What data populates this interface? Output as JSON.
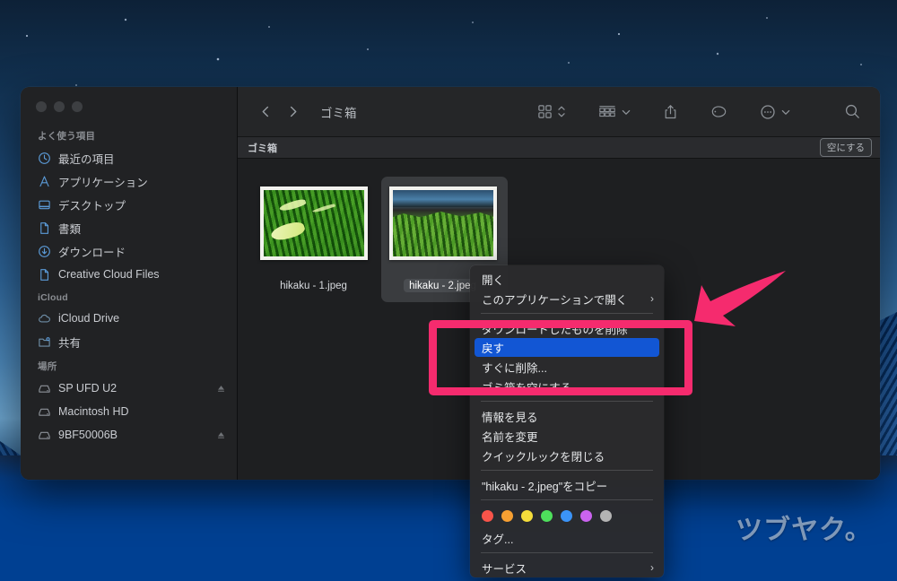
{
  "desktop": {
    "watermark": "ツブヤク。"
  },
  "window": {
    "title": "ゴミ箱",
    "traffic_lights": [
      "close",
      "minimize",
      "zoom"
    ]
  },
  "toolbar": {
    "back_icon": "chevron-left-icon",
    "forward_icon": "chevron-right-icon",
    "view_icon": "grid-view-icon",
    "view_stepper_icon": "chevron-updown-icon",
    "group_icon": "group-by-icon",
    "group_chevron_icon": "chevron-down-icon",
    "share_icon": "share-icon",
    "tag_icon": "tag-icon",
    "more_icon": "ellipsis-circle-icon",
    "more_chevron_icon": "chevron-down-icon",
    "search_icon": "search-icon"
  },
  "pathbar": {
    "title": "ゴミ箱",
    "empty_button": "空にする"
  },
  "sidebar": {
    "groups": [
      {
        "label": "よく使う項目",
        "items": [
          {
            "label": "最近の項目",
            "icon": "clock-icon"
          },
          {
            "label": "アプリケーション",
            "icon": "applications-icon"
          },
          {
            "label": "デスクトップ",
            "icon": "desktop-icon"
          },
          {
            "label": "書類",
            "icon": "document-icon"
          },
          {
            "label": "ダウンロード",
            "icon": "download-icon"
          },
          {
            "label": "Creative Cloud Files",
            "icon": "document-icon"
          }
        ]
      },
      {
        "label": "iCloud",
        "items": [
          {
            "label": "iCloud Drive",
            "icon": "cloud-icon"
          },
          {
            "label": "共有",
            "icon": "shared-folder-icon"
          }
        ]
      },
      {
        "label": "場所",
        "items": [
          {
            "label": "SP UFD U2",
            "icon": "drive-icon",
            "eject": true
          },
          {
            "label": "Macintosh HD",
            "icon": "drive-icon"
          },
          {
            "label": "9BF50006B",
            "icon": "drive-icon"
          }
        ]
      }
    ]
  },
  "files": [
    {
      "name": "hikaku - 1.jpeg",
      "selected": false
    },
    {
      "name": "hikaku - 2.jpeg",
      "selected": true
    }
  ],
  "context_menu": {
    "items": [
      {
        "label": "開く",
        "type": "item"
      },
      {
        "label": "このアプリケーションで開く",
        "type": "submenu",
        "arrow": "›"
      },
      {
        "type": "separator"
      },
      {
        "label": "ダウンロードしたものを削除",
        "type": "item"
      },
      {
        "label": "戻す",
        "type": "item",
        "highlighted": true
      },
      {
        "label": "すぐに削除...",
        "type": "item"
      },
      {
        "label": "ゴミ箱を空にする",
        "type": "item"
      },
      {
        "type": "separator"
      },
      {
        "label": "情報を見る",
        "type": "item"
      },
      {
        "label": "名前を変更",
        "type": "item"
      },
      {
        "label": "クイックルックを閉じる",
        "type": "item"
      },
      {
        "type": "separator"
      },
      {
        "label": "\"hikaku - 2.jpeg\"をコピー",
        "type": "item"
      },
      {
        "type": "separator"
      },
      {
        "type": "tags"
      },
      {
        "label": "タグ...",
        "type": "item"
      },
      {
        "type": "separator"
      },
      {
        "label": "サービス",
        "type": "submenu",
        "arrow": "›"
      }
    ],
    "tag_colors": [
      "#f9544a",
      "#f7a032",
      "#f5dd3b",
      "#4ee05c",
      "#3b93f7",
      "#cb63f0",
      "#b4b4b4"
    ],
    "highlight_color": "#1256d4"
  },
  "annotations": {
    "highlight_rect_color": "#f52b6e",
    "arrow_color": "#f52b6e",
    "arrow_points_to": "戻す"
  }
}
